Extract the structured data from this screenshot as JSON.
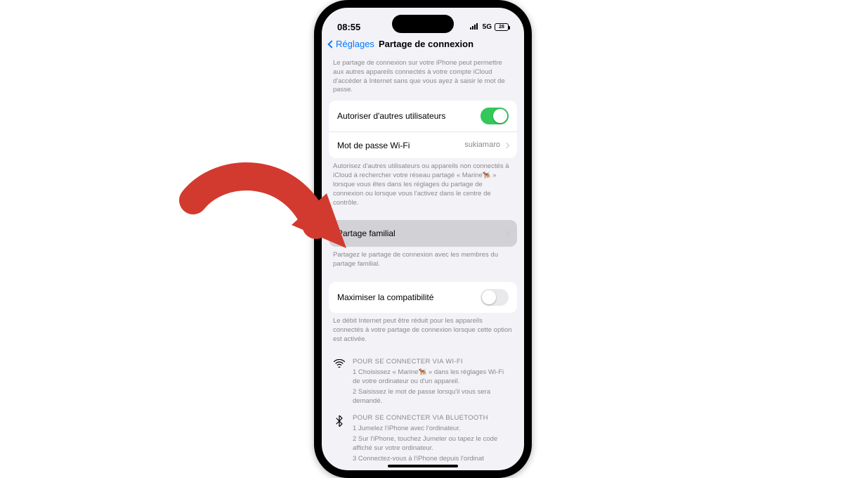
{
  "status": {
    "time": "08:55",
    "network": "5G",
    "battery": "28"
  },
  "nav": {
    "back": "Réglages",
    "title": "Partage de connexion"
  },
  "intro": "Le partage de connexion sur votre iPhone peut permettre aux autres appareils connectés à votre compte iCloud d'accéder à Internet sans que vous ayez à saisir le mot de passe.",
  "group1": {
    "allow_label": "Autoriser d'autres utilisateurs",
    "wifi_label": "Mot de passe Wi-Fi",
    "wifi_value": "sukiamaro"
  },
  "help1": "Autorisez d'autres utilisateurs ou appareils non connectés à iCloud à rechercher votre réseau partagé « Marine🐕‍🦺 » lorsque vous êtes dans les réglages du partage de connexion ou lorsque vous l'activez dans le centre de contrôle.",
  "family": {
    "label": "Partage familial",
    "help": "Partagez le partage de connexion avec les membres du partage familial."
  },
  "compat": {
    "label": "Maximiser la compatibilité",
    "help": "Le débit Internet peut être réduit pour les appareils connectés à votre partage de connexion lorsque cette option est activée."
  },
  "wifi_instr": {
    "title": "POUR SE CONNECTER VIA WI-FI",
    "step1": "1 Choisissez « Marine🐕‍🦺 » dans les réglages Wi-Fi de votre ordinateur ou d'un appareil.",
    "step2": "2 Saisissez le mot de passe lorsqu'il vous sera demandé."
  },
  "bt_instr": {
    "title": "POUR SE CONNECTER VIA BLUETOOTH",
    "step1": "1 Jumelez l'iPhone avec l'ordinateur.",
    "step2": "2 Sur l'iPhone, touchez Jumeler ou tapez le code affiché sur votre ordinateur.",
    "step3": "3 Connectez-vous à l'iPhone depuis l'ordinat"
  }
}
